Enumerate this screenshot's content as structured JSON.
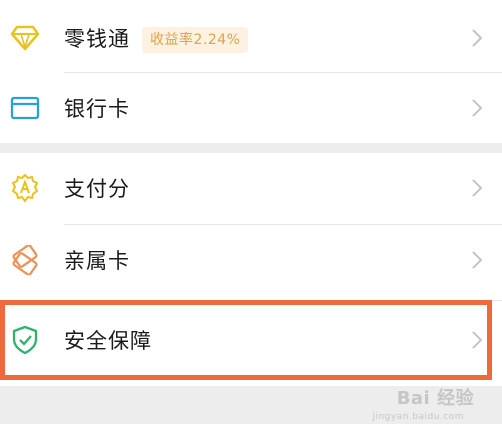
{
  "colors": {
    "background": "#ededed",
    "card": "#ffffff",
    "text": "#1a1a1a",
    "badge_bg": "#fdf1e2",
    "badge_text": "#e0a24a",
    "highlight_border": "#ee6a3c",
    "chevron": "#c4c4c4"
  },
  "menu": {
    "group1": [
      {
        "label": "零钱通",
        "icon": "diamond-icon",
        "badge": "收益率2.24%"
      },
      {
        "label": "银行卡",
        "icon": "bank-card-icon"
      }
    ],
    "group2": [
      {
        "label": "支付分",
        "icon": "pay-score-icon"
      },
      {
        "label": "亲属卡",
        "icon": "family-card-icon"
      },
      {
        "label": "安全保障",
        "icon": "shield-icon",
        "highlighted": true
      }
    ]
  },
  "watermark": {
    "text": "Bai 经验",
    "sub": "jingyan.baidu.com"
  }
}
